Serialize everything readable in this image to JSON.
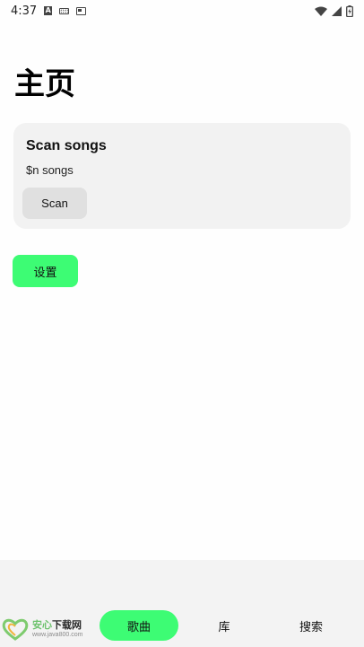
{
  "status_bar": {
    "time": "4:37",
    "icons": [
      "a-icon",
      "keyboard-icon",
      "sim-card-icon",
      "wifi-icon",
      "signal-icon",
      "battery-charging-icon"
    ]
  },
  "page": {
    "title": "主页"
  },
  "scan_card": {
    "title": "Scan songs",
    "subtitle": "$n songs",
    "button_label": "Scan"
  },
  "settings": {
    "button_label": "设置"
  },
  "bottom_nav": {
    "items": [
      {
        "label": "歌曲",
        "active": true
      },
      {
        "label": "库",
        "active": false
      },
      {
        "label": "搜索",
        "active": false
      }
    ]
  },
  "watermark": {
    "name_accent": "安心",
    "name_rest": "下载网",
    "url": "www.java800.com"
  },
  "colors": {
    "accent": "#3dfc74",
    "card_bg": "#f2f2f2",
    "nav_bg": "#f3f3f3"
  }
}
